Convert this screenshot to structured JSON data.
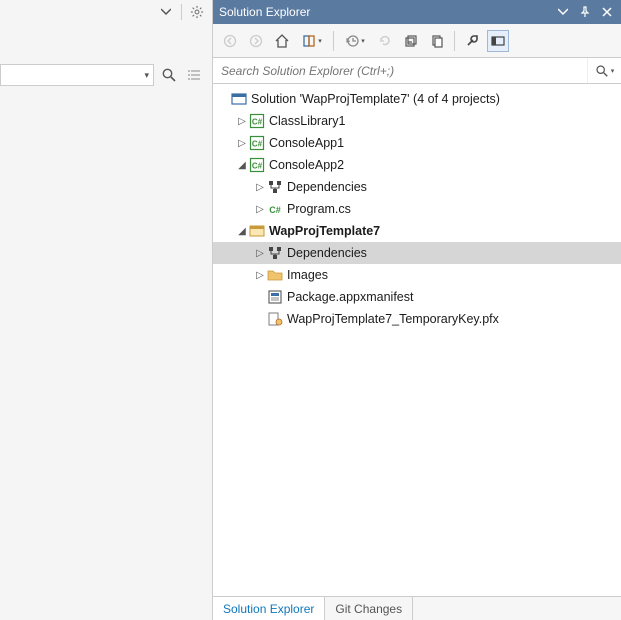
{
  "panel": {
    "title": "Solution Explorer"
  },
  "search": {
    "placeholder": "Search Solution Explorer (Ctrl+;)"
  },
  "tree": {
    "root_label": "Solution 'WapProjTemplate7' (4 of 4 projects)",
    "nodes": {
      "classlib": "ClassLibrary1",
      "consoleapp1": "ConsoleApp1",
      "consoleapp2": "ConsoleApp2",
      "deps1": "Dependencies",
      "programcs": "Program.cs",
      "wapproj": "WapProjTemplate7",
      "deps2": "Dependencies",
      "images": "Images",
      "manifest": "Package.appxmanifest",
      "tempkey": "WapProjTemplate7_TemporaryKey.pfx"
    }
  },
  "tabs": {
    "solution_explorer": "Solution Explorer",
    "git_changes": "Git Changes"
  }
}
